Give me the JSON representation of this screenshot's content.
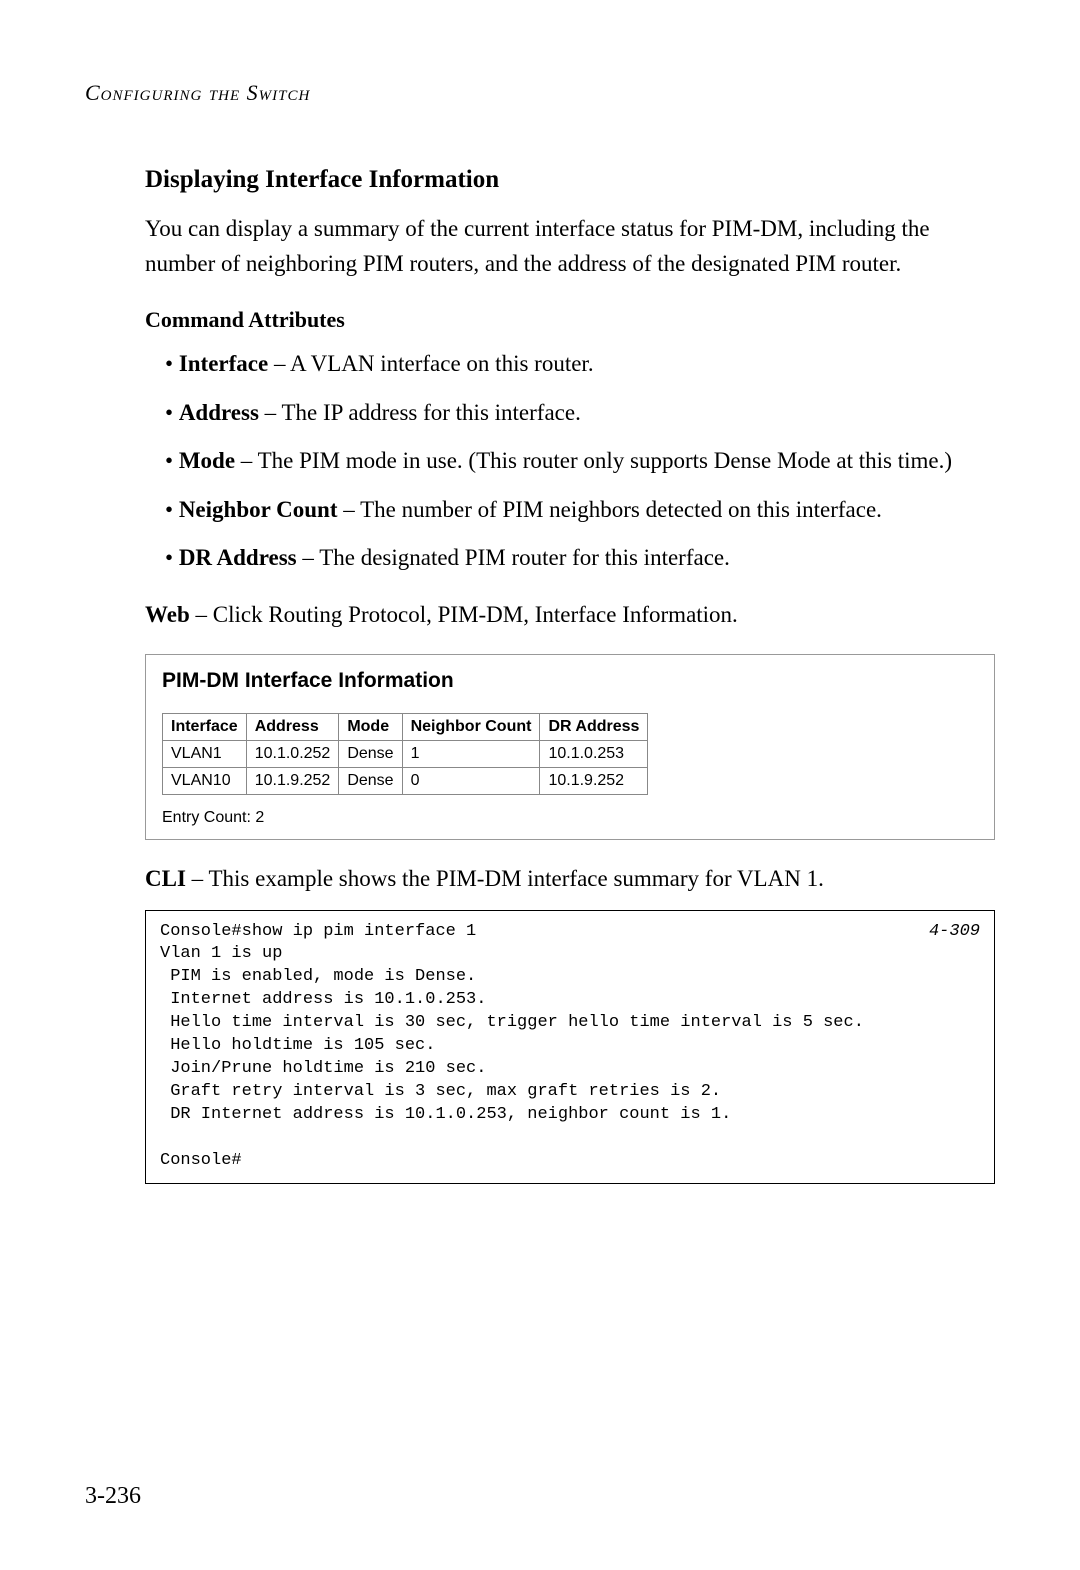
{
  "running_head": "Configuring the Switch",
  "section_heading": "Displaying Interface Information",
  "intro": "You can display a summary of the current interface status for PIM-DM, including the number of neighboring PIM routers, and the address of the designated PIM router.",
  "sub_heading": "Command Attributes",
  "attributes": [
    {
      "term": "Interface",
      "desc": " – A VLAN interface on this router."
    },
    {
      "term": "Address",
      "desc": " – The IP address for this interface."
    },
    {
      "term": "Mode",
      "desc": " – The PIM mode in use. (This router only supports Dense Mode at this time.)"
    },
    {
      "term": "Neighbor Count",
      "desc": " – The number of PIM neighbors detected on this interface."
    },
    {
      "term": "DR Address",
      "desc": " – The designated PIM router for this interface."
    }
  ],
  "web_label": "Web",
  "web_text": " – Click Routing Protocol, PIM-DM, Interface Information.",
  "panel": {
    "title": "PIM-DM Interface Information",
    "headers": [
      "Interface",
      "Address",
      "Mode",
      "Neighbor Count",
      "DR Address"
    ],
    "rows": [
      {
        "interface": "VLAN1",
        "address": "10.1.0.252",
        "mode": "Dense",
        "neighbor_count": "1",
        "dr_address": "10.1.0.253"
      },
      {
        "interface": "VLAN10",
        "address": "10.1.9.252",
        "mode": "Dense",
        "neighbor_count": "0",
        "dr_address": "10.1.9.252"
      }
    ],
    "entry_label": "Entry Count: ",
    "entry_count": "2"
  },
  "cli_label": "CLI",
  "cli_text": " – This example shows the PIM-DM interface summary for VLAN 1.",
  "console": {
    "ref": "4-309",
    "text": "Console#show ip pim interface 1\nVlan 1 is up\n PIM is enabled, mode is Dense.\n Internet address is 10.1.0.253.\n Hello time interval is 30 sec, trigger hello time interval is 5 sec.\n Hello holdtime is 105 sec.\n Join/Prune holdtime is 210 sec.\n Graft retry interval is 3 sec, max graft retries is 2.\n DR Internet address is 10.1.0.253, neighbor count is 1.\n\nConsole#"
  },
  "page_number": "3-236"
}
